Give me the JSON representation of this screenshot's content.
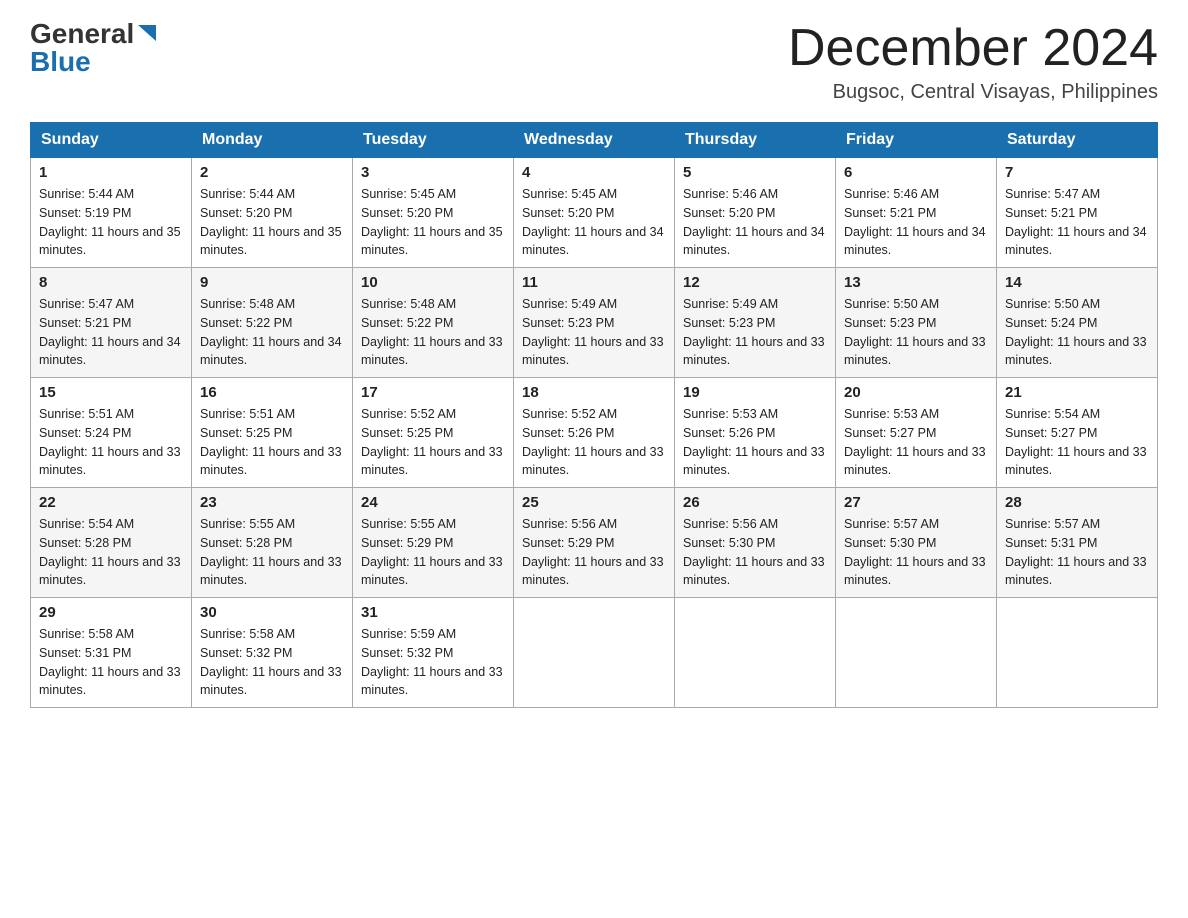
{
  "header": {
    "logo_general": "General",
    "logo_blue": "Blue",
    "month_title": "December 2024",
    "location": "Bugsoc, Central Visayas, Philippines"
  },
  "columns": [
    "Sunday",
    "Monday",
    "Tuesday",
    "Wednesday",
    "Thursday",
    "Friday",
    "Saturday"
  ],
  "weeks": [
    [
      {
        "day": "1",
        "sunrise": "5:44 AM",
        "sunset": "5:19 PM",
        "daylight": "11 hours and 35 minutes."
      },
      {
        "day": "2",
        "sunrise": "5:44 AM",
        "sunset": "5:20 PM",
        "daylight": "11 hours and 35 minutes."
      },
      {
        "day": "3",
        "sunrise": "5:45 AM",
        "sunset": "5:20 PM",
        "daylight": "11 hours and 35 minutes."
      },
      {
        "day": "4",
        "sunrise": "5:45 AM",
        "sunset": "5:20 PM",
        "daylight": "11 hours and 34 minutes."
      },
      {
        "day": "5",
        "sunrise": "5:46 AM",
        "sunset": "5:20 PM",
        "daylight": "11 hours and 34 minutes."
      },
      {
        "day": "6",
        "sunrise": "5:46 AM",
        "sunset": "5:21 PM",
        "daylight": "11 hours and 34 minutes."
      },
      {
        "day": "7",
        "sunrise": "5:47 AM",
        "sunset": "5:21 PM",
        "daylight": "11 hours and 34 minutes."
      }
    ],
    [
      {
        "day": "8",
        "sunrise": "5:47 AM",
        "sunset": "5:21 PM",
        "daylight": "11 hours and 34 minutes."
      },
      {
        "day": "9",
        "sunrise": "5:48 AM",
        "sunset": "5:22 PM",
        "daylight": "11 hours and 34 minutes."
      },
      {
        "day": "10",
        "sunrise": "5:48 AM",
        "sunset": "5:22 PM",
        "daylight": "11 hours and 33 minutes."
      },
      {
        "day": "11",
        "sunrise": "5:49 AM",
        "sunset": "5:23 PM",
        "daylight": "11 hours and 33 minutes."
      },
      {
        "day": "12",
        "sunrise": "5:49 AM",
        "sunset": "5:23 PM",
        "daylight": "11 hours and 33 minutes."
      },
      {
        "day": "13",
        "sunrise": "5:50 AM",
        "sunset": "5:23 PM",
        "daylight": "11 hours and 33 minutes."
      },
      {
        "day": "14",
        "sunrise": "5:50 AM",
        "sunset": "5:24 PM",
        "daylight": "11 hours and 33 minutes."
      }
    ],
    [
      {
        "day": "15",
        "sunrise": "5:51 AM",
        "sunset": "5:24 PM",
        "daylight": "11 hours and 33 minutes."
      },
      {
        "day": "16",
        "sunrise": "5:51 AM",
        "sunset": "5:25 PM",
        "daylight": "11 hours and 33 minutes."
      },
      {
        "day": "17",
        "sunrise": "5:52 AM",
        "sunset": "5:25 PM",
        "daylight": "11 hours and 33 minutes."
      },
      {
        "day": "18",
        "sunrise": "5:52 AM",
        "sunset": "5:26 PM",
        "daylight": "11 hours and 33 minutes."
      },
      {
        "day": "19",
        "sunrise": "5:53 AM",
        "sunset": "5:26 PM",
        "daylight": "11 hours and 33 minutes."
      },
      {
        "day": "20",
        "sunrise": "5:53 AM",
        "sunset": "5:27 PM",
        "daylight": "11 hours and 33 minutes."
      },
      {
        "day": "21",
        "sunrise": "5:54 AM",
        "sunset": "5:27 PM",
        "daylight": "11 hours and 33 minutes."
      }
    ],
    [
      {
        "day": "22",
        "sunrise": "5:54 AM",
        "sunset": "5:28 PM",
        "daylight": "11 hours and 33 minutes."
      },
      {
        "day": "23",
        "sunrise": "5:55 AM",
        "sunset": "5:28 PM",
        "daylight": "11 hours and 33 minutes."
      },
      {
        "day": "24",
        "sunrise": "5:55 AM",
        "sunset": "5:29 PM",
        "daylight": "11 hours and 33 minutes."
      },
      {
        "day": "25",
        "sunrise": "5:56 AM",
        "sunset": "5:29 PM",
        "daylight": "11 hours and 33 minutes."
      },
      {
        "day": "26",
        "sunrise": "5:56 AM",
        "sunset": "5:30 PM",
        "daylight": "11 hours and 33 minutes."
      },
      {
        "day": "27",
        "sunrise": "5:57 AM",
        "sunset": "5:30 PM",
        "daylight": "11 hours and 33 minutes."
      },
      {
        "day": "28",
        "sunrise": "5:57 AM",
        "sunset": "5:31 PM",
        "daylight": "11 hours and 33 minutes."
      }
    ],
    [
      {
        "day": "29",
        "sunrise": "5:58 AM",
        "sunset": "5:31 PM",
        "daylight": "11 hours and 33 minutes."
      },
      {
        "day": "30",
        "sunrise": "5:58 AM",
        "sunset": "5:32 PM",
        "daylight": "11 hours and 33 minutes."
      },
      {
        "day": "31",
        "sunrise": "5:59 AM",
        "sunset": "5:32 PM",
        "daylight": "11 hours and 33 minutes."
      },
      null,
      null,
      null,
      null
    ]
  ]
}
